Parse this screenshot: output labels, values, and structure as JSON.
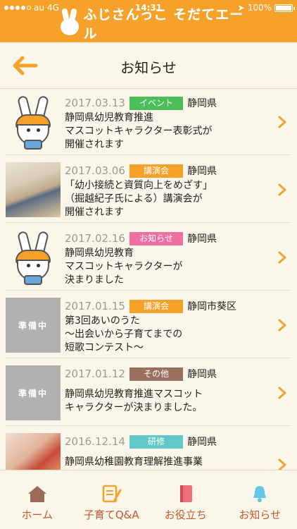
{
  "status": {
    "carrier": "au",
    "network": "4G",
    "time": "14:31",
    "battery": "100%"
  },
  "header": {
    "logo_text": "ふじさんっこ そだてエール"
  },
  "titlebar": {
    "title": "お知らせ"
  },
  "items": [
    {
      "date": "2017.03.13",
      "tag": "イベント",
      "tag_color": "#4cbf5b",
      "region": "静岡県",
      "title": "静岡県幼児教育推進\nマスコットキャラクター表彰式が\n開催されます",
      "thumb": "mascot"
    },
    {
      "date": "2017.03.06",
      "tag": "講演会",
      "tag_color": "#f5a12a",
      "region": "静岡県",
      "title": "「幼小接続と資質向上をめざす」\n（掘越紀子氏による）講演会が\n開催されます",
      "thumb": "photo"
    },
    {
      "date": "2017.02.16",
      "tag": "お知らせ",
      "tag_color": "#ef6f9f",
      "region": "静岡県",
      "title": "静岡県幼児教育\nマスコットキャラクターが\n決まりました",
      "thumb": "mascot"
    },
    {
      "date": "2017.01.15",
      "tag": "講演会",
      "tag_color": "#f5a12a",
      "region": "静岡市葵区",
      "title": "第3回あいのうた\n〜出会いから子育てまでの\n短歌コンテスト〜",
      "thumb": "placeholder",
      "thumb_text": "準備中"
    },
    {
      "date": "2017.01.12",
      "tag": "その他",
      "tag_color": "#9b6f5f",
      "region": "静岡県",
      "title": "静岡県幼児教育推進マスコット\nキャラクターが決まりました。",
      "thumb": "placeholder",
      "thumb_text": "準備中"
    },
    {
      "date": "2016.12.14",
      "tag": "研修",
      "tag_color": "#63c8c8",
      "region": "静岡県",
      "title": "静岡県幼稚園教育理解推進事業",
      "thumb": "photo"
    }
  ],
  "tabs": [
    {
      "label": "ホーム",
      "icon": "home-icon"
    },
    {
      "label": "子育てQ&A",
      "icon": "qa-icon"
    },
    {
      "label": "お役立ち",
      "icon": "book-icon"
    },
    {
      "label": "お知らせ",
      "icon": "bell-icon"
    }
  ],
  "colors": {
    "accent": "#f5a12a",
    "tab_icon": "#9b6b5a",
    "tab_label": "#c35a2e"
  }
}
